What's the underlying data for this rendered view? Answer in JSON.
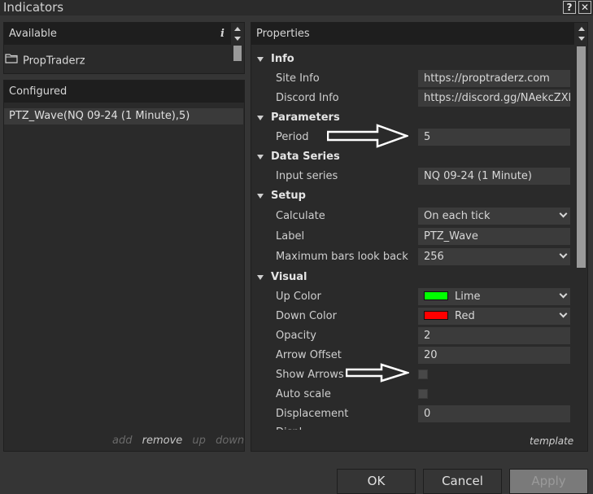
{
  "window": {
    "title": "Indicators",
    "help_glyph": "?",
    "close_glyph": "✕"
  },
  "available": {
    "header": "Available",
    "info_glyph": "i",
    "items": [
      "PropTraderz"
    ]
  },
  "configured": {
    "header": "Configured",
    "items": [
      "PTZ_Wave(NQ 09-24 (1 Minute),5)"
    ],
    "actions": {
      "add": "add",
      "remove": "remove",
      "up": "up",
      "down": "down"
    }
  },
  "properties": {
    "header": "Properties",
    "categories": {
      "info": "Info",
      "parameters": "Parameters",
      "data_series": "Data Series",
      "setup": "Setup",
      "visual": "Visual"
    },
    "labels": {
      "site_info": "Site Info",
      "discord_info": "Discord Info",
      "period": "Period",
      "input_series": "Input series",
      "calculate": "Calculate",
      "label": "Label",
      "max_bars": "Maximum bars look back",
      "up_color": "Up Color",
      "down_color": "Down Color",
      "opacity": "Opacity",
      "arrow_offset": "Arrow Offset",
      "show_arrows": "Show Arrows",
      "auto_scale": "Auto scale",
      "displacement": "Displacement",
      "partial": "Displ..."
    },
    "values": {
      "site_info": "https://proptraderz.com",
      "discord_info": "https://discord.gg/NAekcZXb",
      "period": "5",
      "input_series": "NQ 09-24 (1 Minute)",
      "calculate": "On each tick",
      "label": "PTZ_Wave",
      "max_bars": "256",
      "up_color": "Lime",
      "down_color": "Red",
      "opacity": "2",
      "arrow_offset": "20",
      "displacement": "0"
    },
    "colors": {
      "up": "#00ff00",
      "down": "#ff0000"
    },
    "template_link": "template"
  },
  "buttons": {
    "ok": "OK",
    "cancel": "Cancel",
    "apply": "Apply"
  }
}
